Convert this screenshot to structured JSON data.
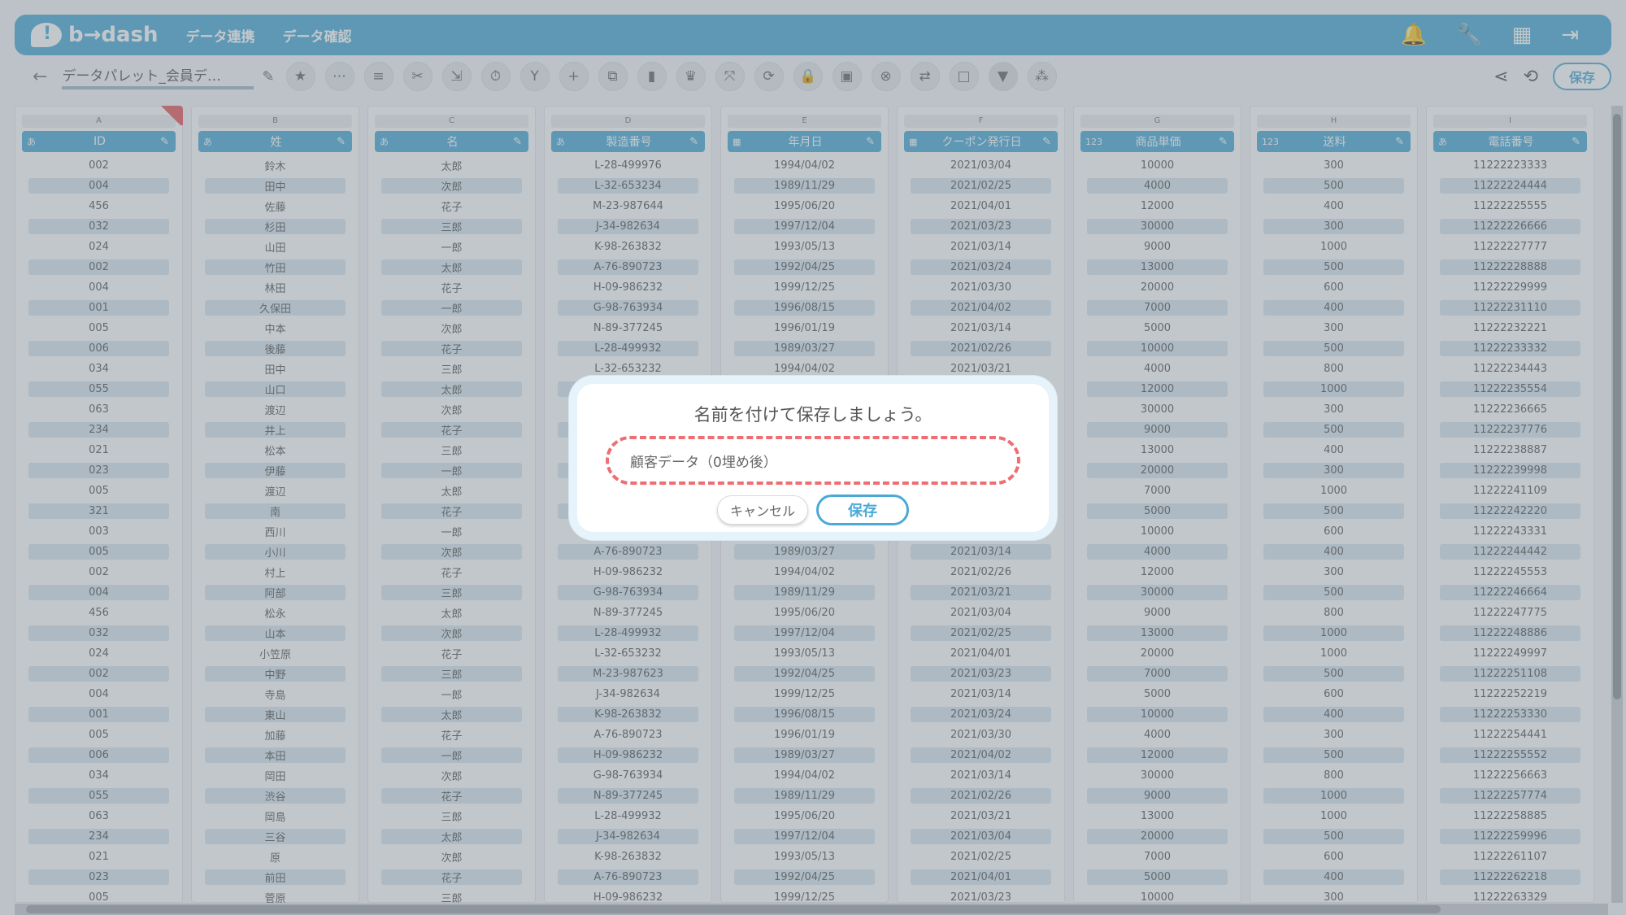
{
  "header": {
    "logo_text": "b→dash",
    "nav": [
      "データ連携",
      "データ確認"
    ],
    "icons": [
      "bell-icon",
      "wrench-icon",
      "apps-grid-icon",
      "logout-icon"
    ]
  },
  "toolbar": {
    "title": "データパレット_会員デ…",
    "save_label": "保存",
    "tools": [
      "star",
      "more",
      "list",
      "scissors",
      "merge",
      "timer",
      "branch",
      "plus",
      "copy",
      "trash",
      "crown",
      "expand",
      "refresh",
      "lock",
      "box",
      "close",
      "replace",
      "square",
      "filter",
      "group"
    ]
  },
  "grid": {
    "columns": [
      {
        "letter": "A",
        "type": "あ",
        "name": "ID",
        "values": [
          "002",
          "004",
          "456",
          "032",
          "024",
          "002",
          "004",
          "001",
          "005",
          "006",
          "034",
          "055",
          "063",
          "234",
          "021",
          "023",
          "005",
          "321",
          "003",
          "005",
          "002",
          "004",
          "456",
          "032",
          "024",
          "002",
          "004",
          "001",
          "005",
          "006",
          "034",
          "055",
          "063",
          "234",
          "021",
          "023",
          "005"
        ]
      },
      {
        "letter": "B",
        "type": "あ",
        "name": "姓",
        "values": [
          "鈴木",
          "田中",
          "佐藤",
          "杉田",
          "山田",
          "竹田",
          "林田",
          "久保田",
          "中本",
          "後藤",
          "田中",
          "山口",
          "渡辺",
          "井上",
          "松本",
          "伊藤",
          "渡辺",
          "南",
          "西川",
          "小川",
          "村上",
          "阿部",
          "松永",
          "山本",
          "小笠原",
          "中野",
          "寺島",
          "東山",
          "加藤",
          "本田",
          "岡田",
          "渋谷",
          "岡島",
          "三谷",
          "原",
          "前田",
          "菅原"
        ]
      },
      {
        "letter": "C",
        "type": "あ",
        "name": "名",
        "values": [
          "太郎",
          "次郎",
          "花子",
          "三郎",
          "一郎",
          "太郎",
          "花子",
          "一郎",
          "次郎",
          "花子",
          "三郎",
          "太郎",
          "次郎",
          "花子",
          "三郎",
          "一郎",
          "太郎",
          "花子",
          "一郎",
          "次郎",
          "花子",
          "三郎",
          "太郎",
          "次郎",
          "花子",
          "三郎",
          "一郎",
          "太郎",
          "花子",
          "一郎",
          "次郎",
          "花子",
          "三郎",
          "太郎",
          "次郎",
          "花子",
          "三郎"
        ]
      },
      {
        "letter": "D",
        "type": "あ",
        "name": "製造番号",
        "values": [
          "L-28-499976",
          "L-32-653234",
          "M-23-987644",
          "J-34-982634",
          "K-98-263832",
          "A-76-890723",
          "H-09-986232",
          "G-98-763934",
          "N-89-377245",
          "L-28-499932",
          "L-32-653232",
          "",
          "",
          "",
          "",
          "",
          "",
          "",
          "",
          "A-76-890723",
          "H-09-986232",
          "G-98-763934",
          "N-89-377245",
          "L-28-499932",
          "L-32-653232",
          "M-23-987623",
          "J-34-982634",
          "K-98-263832",
          "A-76-890723",
          "H-09-986232",
          "G-98-763934",
          "N-89-377245",
          "L-28-499932",
          "J-34-982634",
          "K-98-263832",
          "A-76-890723",
          "H-09-986232"
        ]
      },
      {
        "letter": "E",
        "type": "cal",
        "name": "年月日",
        "values": [
          "1994/04/02",
          "1989/11/29",
          "1995/06/20",
          "1997/12/04",
          "1993/05/13",
          "1992/04/25",
          "1999/12/25",
          "1996/08/15",
          "1996/01/19",
          "1989/03/27",
          "1994/04/02",
          "",
          "",
          "",
          "",
          "",
          "",
          "",
          "",
          "1989/03/27",
          "1994/04/02",
          "1989/11/29",
          "1995/06/20",
          "1997/12/04",
          "1993/05/13",
          "1992/04/25",
          "1999/12/25",
          "1996/08/15",
          "1996/01/19",
          "1989/03/27",
          "1994/04/02",
          "1989/11/29",
          "1995/06/20",
          "1997/12/04",
          "1993/05/13",
          "1992/04/25",
          "1999/12/25"
        ]
      },
      {
        "letter": "F",
        "type": "cal",
        "name": "クーポン発行日",
        "values": [
          "2021/03/04",
          "2021/02/25",
          "2021/04/01",
          "2021/03/23",
          "2021/03/14",
          "2021/03/24",
          "2021/03/30",
          "2021/04/02",
          "2021/03/14",
          "2021/02/26",
          "2021/03/21",
          "",
          "",
          "",
          "",
          "",
          "",
          "",
          "",
          "2021/03/14",
          "2021/02/26",
          "2021/03/21",
          "2021/03/04",
          "2021/02/25",
          "2021/04/01",
          "2021/03/23",
          "2021/03/14",
          "2021/03/24",
          "2021/03/30",
          "2021/04/02",
          "2021/03/14",
          "2021/02/26",
          "2021/03/21",
          "2021/03/04",
          "2021/02/25",
          "2021/04/01",
          "2021/03/23"
        ]
      },
      {
        "letter": "G",
        "type": "123",
        "name": "商品単価",
        "values": [
          "10000",
          "4000",
          "12000",
          "30000",
          "9000",
          "13000",
          "20000",
          "7000",
          "5000",
          "10000",
          "4000",
          "12000",
          "30000",
          "9000",
          "13000",
          "20000",
          "7000",
          "5000",
          "10000",
          "4000",
          "12000",
          "30000",
          "9000",
          "13000",
          "20000",
          "7000",
          "5000",
          "10000",
          "4000",
          "12000",
          "30000",
          "9000",
          "13000",
          "20000",
          "7000",
          "5000",
          "10000"
        ]
      },
      {
        "letter": "H",
        "type": "123",
        "name": "送料",
        "values": [
          "300",
          "500",
          "400",
          "300",
          "1000",
          "500",
          "600",
          "400",
          "300",
          "500",
          "800",
          "1000",
          "300",
          "500",
          "400",
          "300",
          "1000",
          "500",
          "600",
          "400",
          "300",
          "500",
          "800",
          "1000",
          "1000",
          "500",
          "600",
          "400",
          "300",
          "500",
          "800",
          "1000",
          "1000",
          "500",
          "600",
          "400",
          "300"
        ]
      },
      {
        "letter": "I",
        "type": "あ",
        "name": "電話番号",
        "values": [
          "11222223333",
          "11222224444",
          "11222225555",
          "11222226666",
          "11222227777",
          "11222228888",
          "11222229999",
          "11222231110",
          "11222232221",
          "11222233332",
          "11222234443",
          "11222235554",
          "11222236665",
          "11222237776",
          "11222238887",
          "11222239998",
          "11222241109",
          "11222242220",
          "11222243331",
          "11222244442",
          "11222245553",
          "11222246664",
          "11222247775",
          "11222248886",
          "11222249997",
          "11222251108",
          "11222252219",
          "11222253330",
          "11222254441",
          "11222255552",
          "11222256663",
          "11222257774",
          "11222258885",
          "11222259996",
          "11222261107",
          "11222262218",
          "11222263329"
        ]
      }
    ]
  },
  "dialog": {
    "title": "名前を付けて保存しましょう。",
    "input_value": "顧客データ（0埋め後）",
    "cancel_label": "キャンセル",
    "save_label": "保存"
  }
}
